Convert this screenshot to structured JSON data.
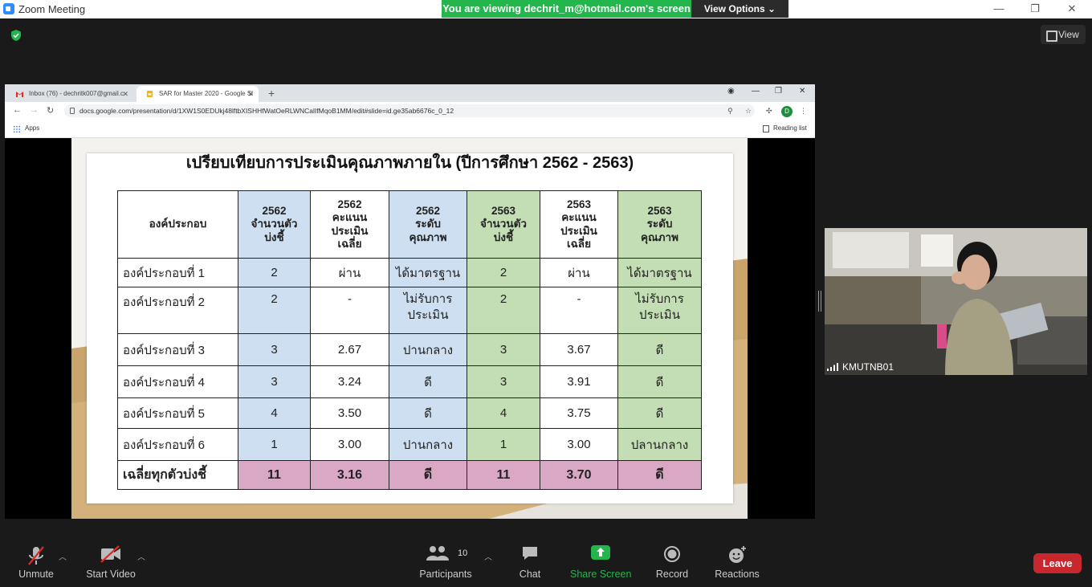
{
  "window": {
    "title": "Zoom Meeting",
    "banner": "You are viewing dechrit_m@hotmail.com's screen",
    "view_options": "View Options",
    "view_label": "View",
    "minimize": "—",
    "maximize": "❐",
    "close": "✕"
  },
  "browser": {
    "tabs": [
      {
        "label": "Inbox (76) - dechritk007@gmail.c",
        "icon": "gmail-icon"
      },
      {
        "label": "SAR for Master 2020 - Google Sl",
        "icon": "slides-icon"
      }
    ],
    "new_tab": "+",
    "url": "docs.google.com/presentation/d/1XW1S0EDUkj48lftbXISHHfWatOeRLWNCalIfMqoB1MM/edit#slide=id.ge35ab6676c_0_12",
    "profile_initial": "D",
    "apps_label": "Apps",
    "reading_list": "Reading list"
  },
  "slide": {
    "title": "เปรียบเทียบการประเมินคุณภาพภายใน (ปีการศึกษา 2562 - 2563)",
    "table": {
      "headers": [
        {
          "lines": [
            "องค์ประกอบ"
          ],
          "color": "white"
        },
        {
          "lines": [
            "2562",
            "จำนวนตัว",
            "บ่งชี้"
          ],
          "color": "blue"
        },
        {
          "lines": [
            "2562",
            "คะแนน",
            "ประเมิน",
            "เฉลี่ย"
          ],
          "color": "white"
        },
        {
          "lines": [
            "2562",
            "ระดับ",
            "คุณภาพ"
          ],
          "color": "blue"
        },
        {
          "lines": [
            "2563",
            "จำนวนตัว",
            "บ่งชี้"
          ],
          "color": "green"
        },
        {
          "lines": [
            "2563",
            "คะแนน",
            "ประเมิน",
            "เฉลี่ย"
          ],
          "color": "white"
        },
        {
          "lines": [
            "2563",
            "ระดับ",
            "คุณภาพ"
          ],
          "color": "green"
        }
      ],
      "rows": [
        [
          "องค์ประกอบที่ 1",
          "2",
          "ผ่าน",
          "ได้มาตรฐาน",
          "2",
          "ผ่าน",
          "ได้มาตรฐาน"
        ],
        [
          "องค์ประกอบที่ 2",
          "2",
          "-",
          "ไม่รับการประเมิน",
          "2",
          "-",
          "ไม่รับการประเมิน"
        ],
        [
          "องค์ประกอบที่ 3",
          "3",
          "2.67",
          "ปานกลาง",
          "3",
          "3.67",
          "ดี"
        ],
        [
          "องค์ประกอบที่ 4",
          "3",
          "3.24",
          "ดี",
          "3",
          "3.91",
          "ดี"
        ],
        [
          "องค์ประกอบที่ 5",
          "4",
          "3.50",
          "ดี",
          "4",
          "3.75",
          "ดี"
        ],
        [
          "องค์ประกอบที่ 6",
          "1",
          "3.00",
          "ปานกลาง",
          "1",
          "3.00",
          "ปลานกลาง"
        ]
      ],
      "total": [
        "เฉลี่ยทุกตัวบ่งชี้",
        "11",
        "3.16",
        "ดี",
        "11",
        "3.70",
        "ดี"
      ]
    }
  },
  "video": {
    "participant_name": "KMUTNB01"
  },
  "toolbar": {
    "unmute": "Unmute",
    "start_video": "Start Video",
    "participants": "Participants",
    "participants_count": "10",
    "chat": "Chat",
    "share_screen": "Share Screen",
    "record": "Record",
    "reactions": "Reactions",
    "leave": "Leave"
  },
  "colors": {
    "share_green": "#23b64d",
    "leave_red": "#c8282d",
    "table_blue": "#cddff0",
    "table_green": "#c3deb4",
    "table_pink": "#d9a8c5"
  }
}
